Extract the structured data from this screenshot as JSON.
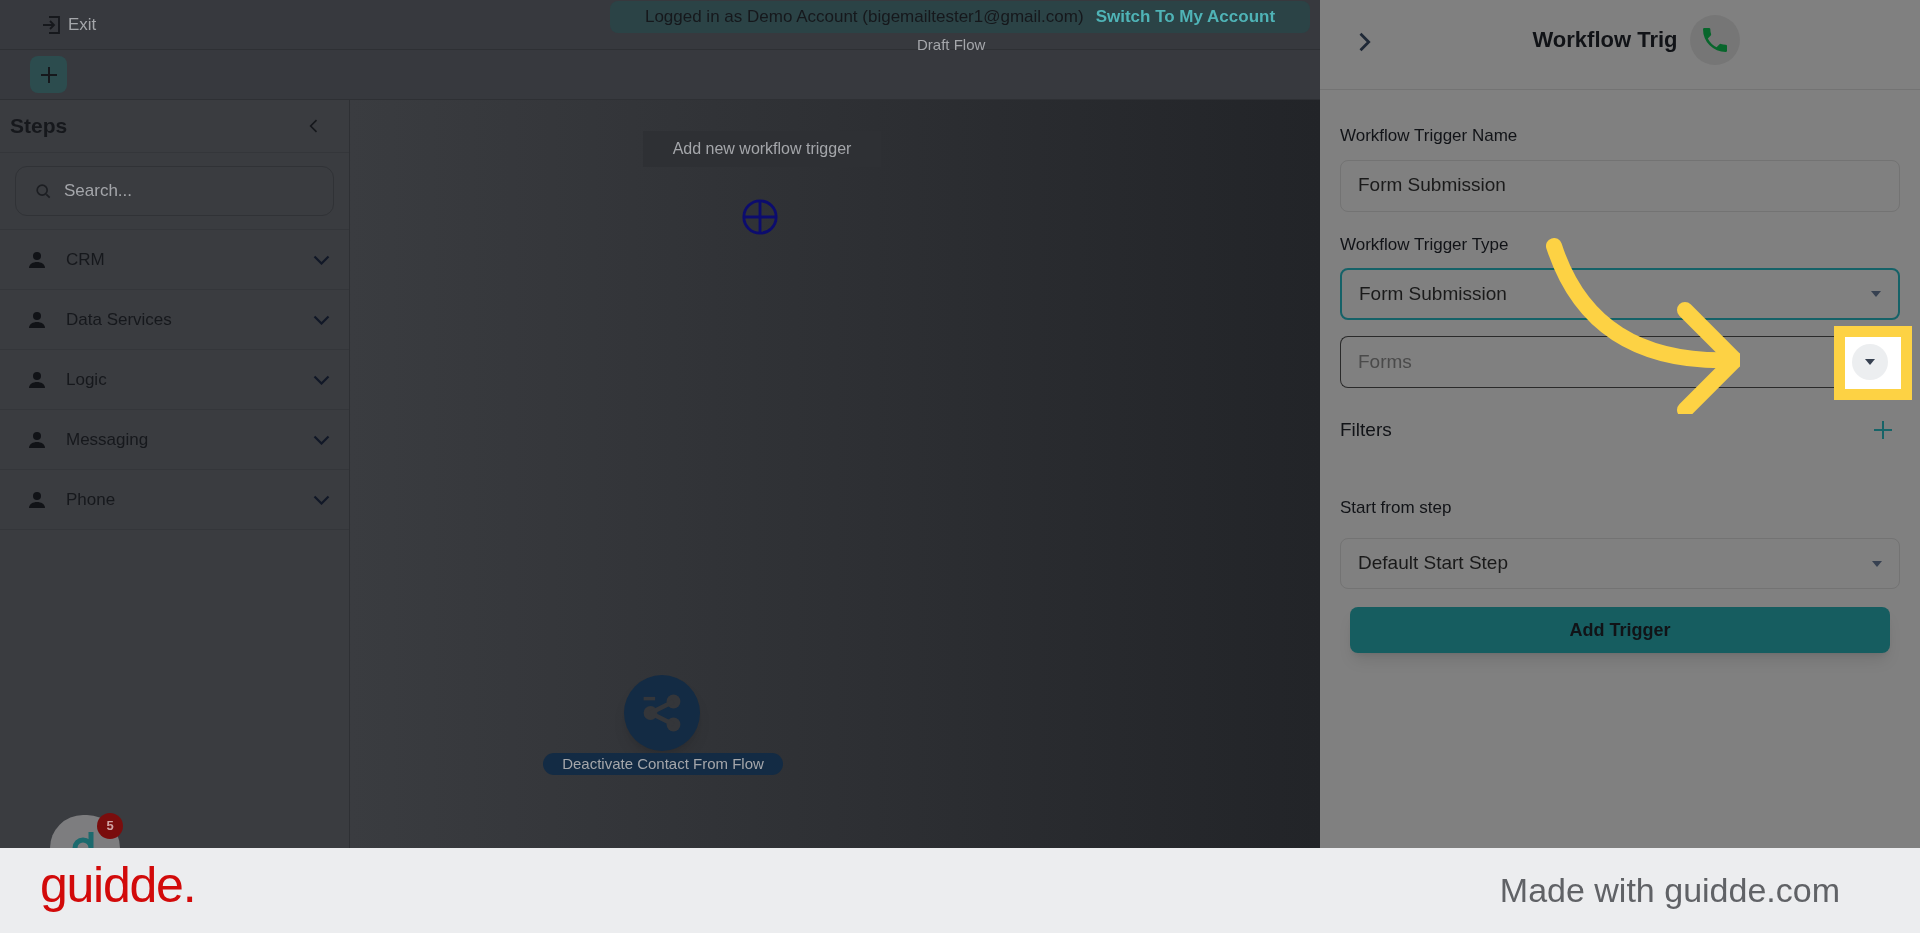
{
  "top_bar": {
    "exit_label": "Exit"
  },
  "banner": {
    "text": "Logged in as Demo Account (bigemailtester1@gmail.com)",
    "link": "Switch To My Account"
  },
  "canvas": {
    "title": "Draft Flow",
    "trigger_placeholder": "Add new workflow trigger",
    "node_label": "Deactivate Contact From Flow"
  },
  "sidebar": {
    "title": "Steps",
    "search": {
      "placeholder": "Search..."
    },
    "items": [
      {
        "label": "CRM",
        "expanded": false
      },
      {
        "label": "Data Services",
        "expanded": false
      },
      {
        "label": "Logic",
        "expanded": false
      },
      {
        "label": "Messaging",
        "expanded": false
      },
      {
        "label": "Phone",
        "expanded": false
      }
    ]
  },
  "chat": {
    "badge": "5"
  },
  "panel": {
    "title": "Workflow Trig",
    "fields": [
      {
        "kind": "input",
        "label": "Workflow Trigger Name",
        "value": "Form Submission",
        "focused": false
      },
      {
        "kind": "select",
        "label": "Workflow Trigger Type",
        "value": "Form Submission",
        "focused": true
      },
      {
        "kind": "select",
        "placeholder": "Forms",
        "focused": false,
        "highlighted": true
      }
    ],
    "filters_label": "Filters",
    "start_label": "Start from step",
    "start_value": "Default Start Step",
    "button": "Add Trigger"
  },
  "footer": {
    "logo": "guidde.",
    "credit": "Made with guidde.com"
  }
}
